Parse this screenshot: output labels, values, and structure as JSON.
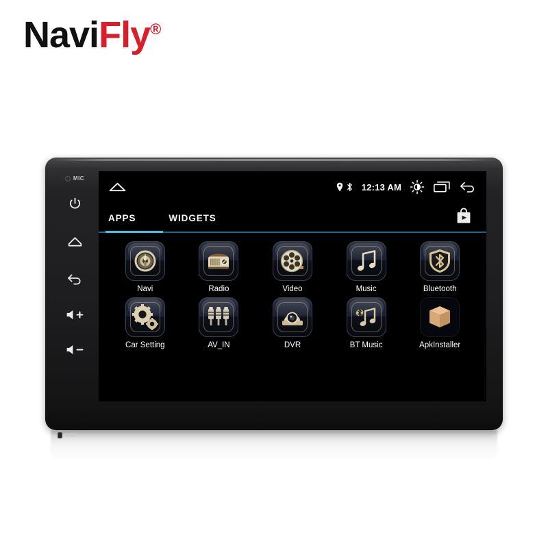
{
  "brand": {
    "part1": "Navi",
    "part2": "Fly",
    "registered": "®"
  },
  "device": {
    "bezel": {
      "mic_label": "MIC",
      "reset_label": "RST",
      "buttons": [
        {
          "name": "power-button",
          "label": "power-icon"
        },
        {
          "name": "home-button",
          "label": "home-icon"
        },
        {
          "name": "back-button",
          "label": "back-arrow-icon"
        },
        {
          "name": "volume-up-button",
          "label": "volume-up-icon"
        },
        {
          "name": "volume-down-button",
          "label": "volume-down-icon"
        }
      ]
    }
  },
  "screen": {
    "statusbar": {
      "home_icon": "home-icon",
      "location_icon": "location-pin-icon",
      "bluetooth_icon": "bluetooth-icon",
      "clock": "12:13 AM",
      "brightness_icon": "brightness-sun-icon",
      "recents_icon": "recents-icon",
      "back_icon": "back-arrow-icon"
    },
    "tabs": [
      {
        "label": "APPS",
        "active": true
      },
      {
        "label": "WIDGETS",
        "active": false
      }
    ],
    "playstore_icon": "play-store-bag-icon",
    "accent_color": "#3fc6f0",
    "divider_color": "#0f6f86",
    "apps": [
      {
        "label": "Navi",
        "icon": "compass-icon"
      },
      {
        "label": "Radio",
        "icon": "retro-radio-icon"
      },
      {
        "label": "Video",
        "icon": "film-reel-icon"
      },
      {
        "label": "Music",
        "icon": "music-note-icon"
      },
      {
        "label": "Bluetooth",
        "icon": "bluetooth-shield-icon"
      },
      {
        "label": "Car Setting",
        "icon": "gears-icon"
      },
      {
        "label": "AV_IN",
        "icon": "rca-plugs-icon"
      },
      {
        "label": "DVR",
        "icon": "dome-camera-icon"
      },
      {
        "label": "BT Music",
        "icon": "bluetooth-music-note-icon"
      },
      {
        "label": "ApkInstaller",
        "icon": "cardboard-box-icon"
      }
    ]
  }
}
